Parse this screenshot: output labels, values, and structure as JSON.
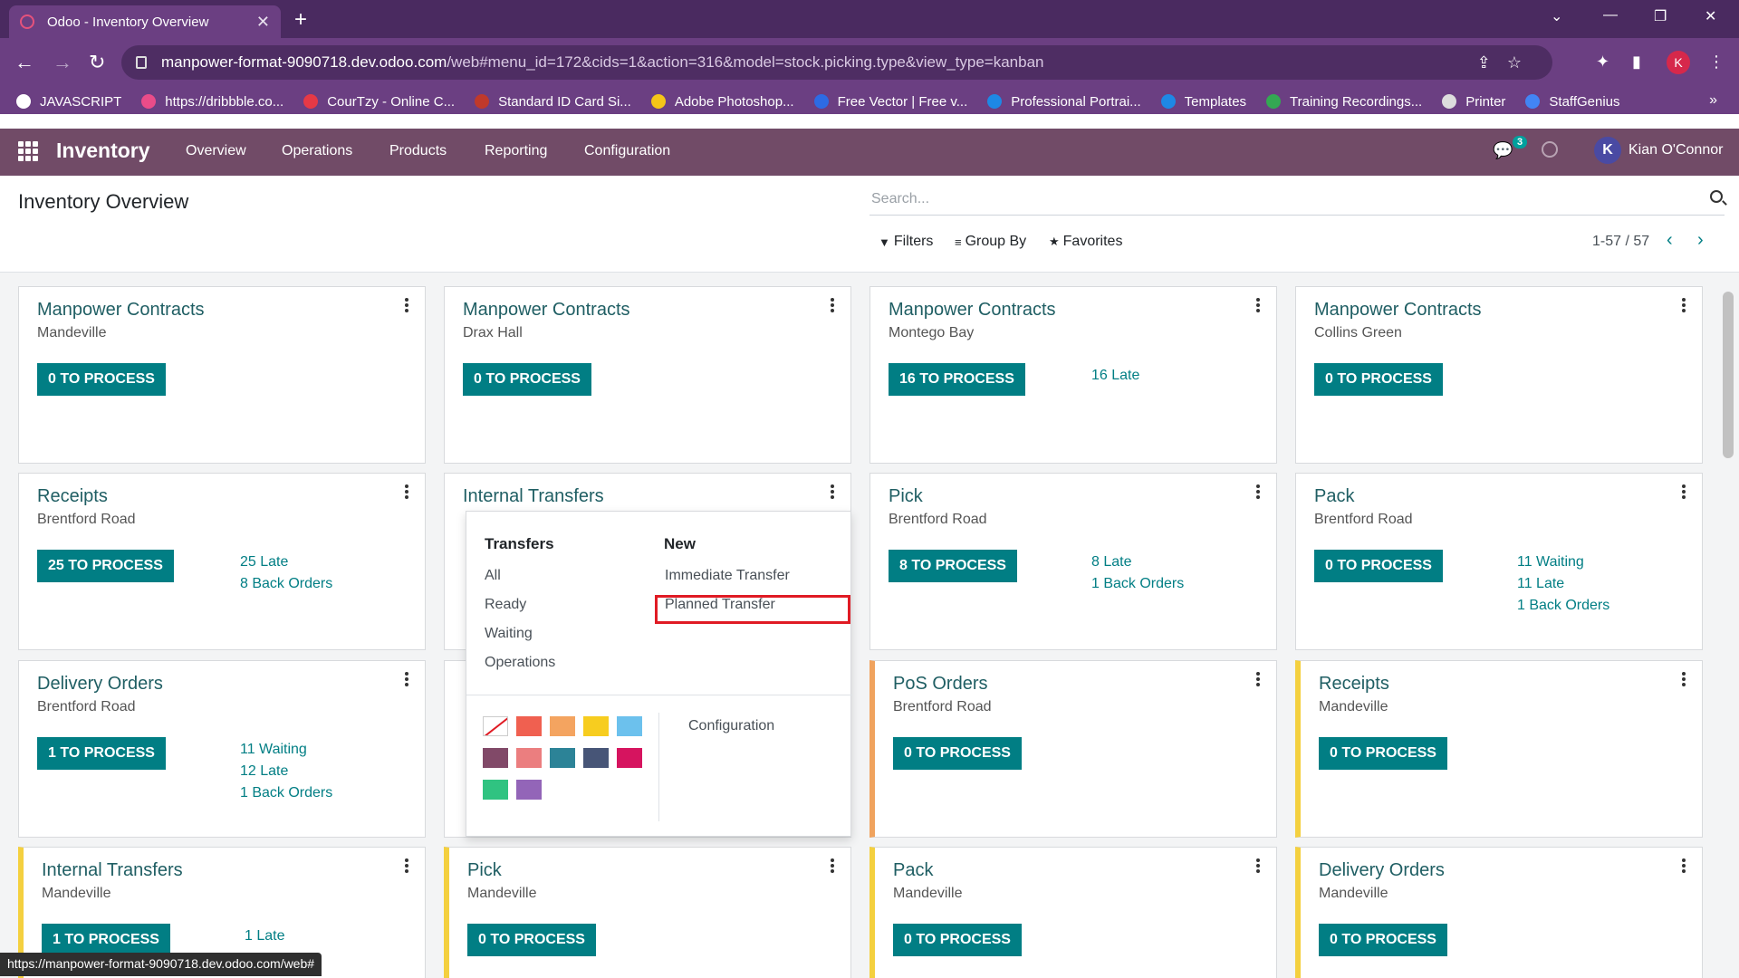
{
  "browser": {
    "tab_title": "Odoo - Inventory Overview",
    "url_host": "manpower-format-9090718.dev.odoo.com",
    "url_path": "/web#menu_id=172&cids=1&action=316&model=stock.picking.type&view_type=kanban",
    "bookmarks": [
      {
        "label": "JAVASCRIPT",
        "color": "#ffffff"
      },
      {
        "label": "https://dribbble.co...",
        "color": "#ea4c89"
      },
      {
        "label": "CourTzy - Online C...",
        "color": "#e63946"
      },
      {
        "label": "Standard ID Card Si...",
        "color": "#c0392b"
      },
      {
        "label": "Adobe Photoshop...",
        "color": "#f5c518"
      },
      {
        "label": "Free Vector | Free v...",
        "color": "#2d6be4"
      },
      {
        "label": "Professional Portrai...",
        "color": "#1e88e5"
      },
      {
        "label": "Templates",
        "color": "#1e88e5"
      },
      {
        "label": "Training Recordings...",
        "color": "#34a853"
      },
      {
        "label": "Printer",
        "color": "#dddddd"
      },
      {
        "label": "StaffGenius",
        "color": "#4285f4"
      }
    ],
    "profile_initial": "K",
    "status_url": "https://manpower-format-9090718.dev.odoo.com/web#"
  },
  "navbar": {
    "brand": "Inventory",
    "menu": [
      "Overview",
      "Operations",
      "Products",
      "Reporting",
      "Configuration"
    ],
    "chat_count": "3",
    "user_initial": "K",
    "user_name": "Kian O'Connor"
  },
  "control_panel": {
    "title": "Inventory Overview",
    "search_placeholder": "Search...",
    "filters_label": "Filters",
    "groupby_label": "Group By",
    "favorites_label": "Favorites",
    "pager": "1-57 / 57"
  },
  "cards": [
    {
      "name": "Manpower Contracts",
      "sub": "Mandeville",
      "btn": "0 TO PROCESS",
      "stats": []
    },
    {
      "name": "Manpower Contracts",
      "sub": "Drax Hall",
      "btn": "0 TO PROCESS",
      "stats": []
    },
    {
      "name": "Manpower Contracts",
      "sub": "Montego Bay",
      "btn": "16 TO PROCESS",
      "stats": [
        "16 Late"
      ]
    },
    {
      "name": "Manpower Contracts",
      "sub": "Collins Green",
      "btn": "0 TO PROCESS",
      "stats": []
    },
    {
      "name": "Receipts",
      "sub": "Brentford Road",
      "btn": "25 TO PROCESS",
      "stats": [
        "25 Late",
        "8 Back Orders"
      ]
    },
    {
      "name": "Internal Transfers",
      "sub": "",
      "btn": "",
      "stats": []
    },
    {
      "name": "Pick",
      "sub": "Brentford Road",
      "btn": "8 TO PROCESS",
      "stats": [
        "8 Late",
        "1 Back Orders"
      ]
    },
    {
      "name": "Pack",
      "sub": "Brentford Road",
      "btn": "0 TO PROCESS",
      "stats": [
        "11 Waiting",
        "11 Late",
        "1 Back Orders"
      ]
    },
    {
      "name": "Delivery Orders",
      "sub": "Brentford Road",
      "btn": "1 TO PROCESS",
      "stats": [
        "11 Waiting",
        "12 Late",
        "1 Back Orders"
      ]
    },
    {
      "name": "",
      "sub": "",
      "btn": "",
      "stats": []
    },
    {
      "name": "PoS Orders",
      "sub": "Brentford Road",
      "btn": "0 TO PROCESS",
      "stats": []
    },
    {
      "name": "Receipts",
      "sub": "Mandeville",
      "btn": "0 TO PROCESS",
      "stats": []
    },
    {
      "name": "Internal Transfers",
      "sub": "Mandeville",
      "btn": "1 TO PROCESS",
      "stats": [
        "1 Late"
      ]
    },
    {
      "name": "Pick",
      "sub": "Mandeville",
      "btn": "0 TO PROCESS",
      "stats": []
    },
    {
      "name": "Pack",
      "sub": "Mandeville",
      "btn": "0 TO PROCESS",
      "stats": []
    },
    {
      "name": "Delivery Orders",
      "sub": "Mandeville",
      "btn": "0 TO PROCESS",
      "stats": []
    }
  ],
  "dropdown": {
    "transfers_heading": "Transfers",
    "transfers": [
      "All",
      "Ready",
      "Waiting",
      "Operations"
    ],
    "new_heading": "New",
    "new_items": [
      "Immediate Transfer",
      "Planned Transfer"
    ],
    "configuration": "Configuration",
    "colors": [
      "#f06050",
      "#f4a460",
      "#f7cd1f",
      "#6cc1ed",
      "#814968",
      "#eb7e7f",
      "#2c8397",
      "#475577",
      "#d6145f",
      "#30c381",
      "#9365b8"
    ]
  }
}
